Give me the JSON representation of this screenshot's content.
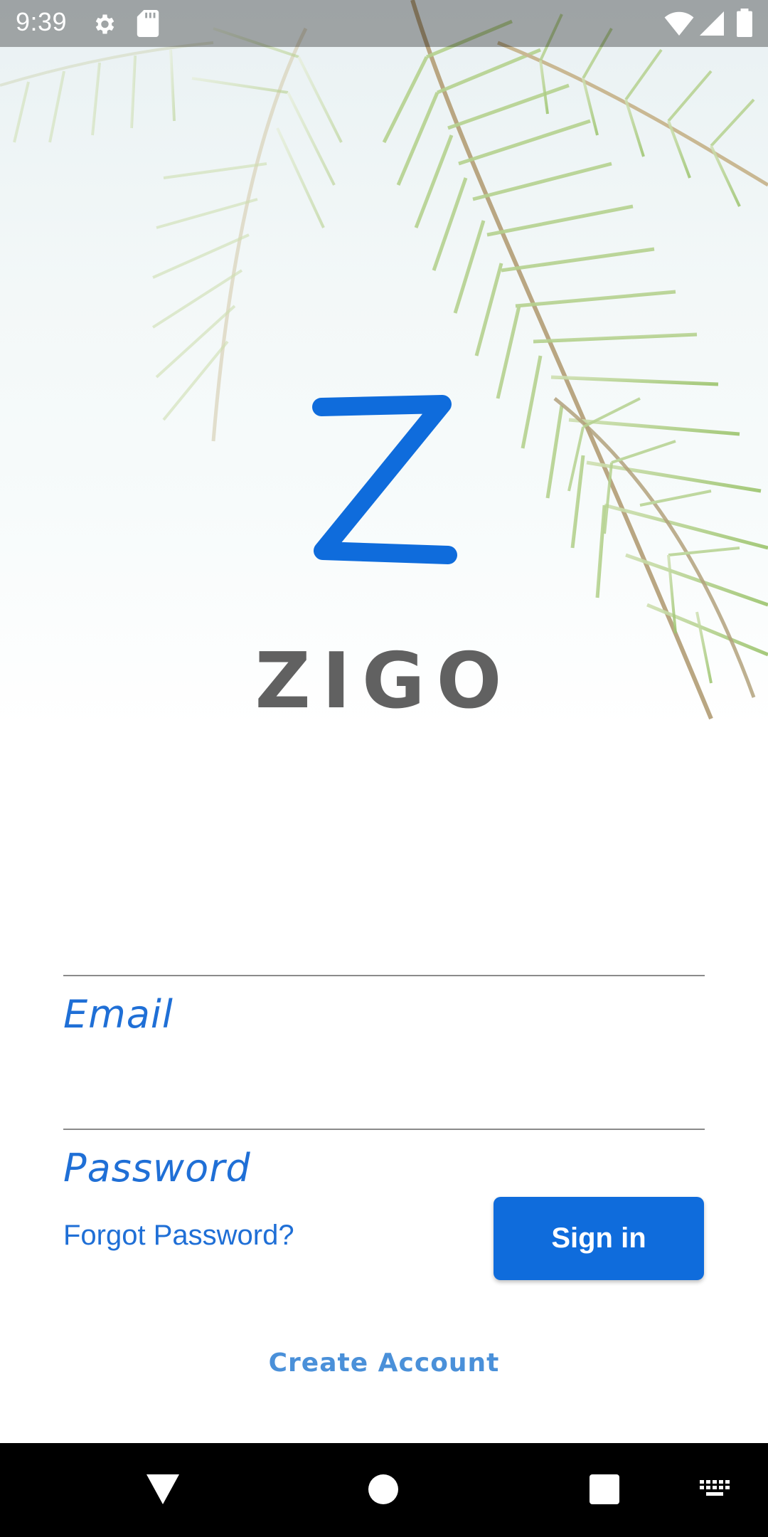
{
  "status_bar": {
    "time": "9:39",
    "icons": [
      "settings-icon",
      "sd-card-icon",
      "wifi-icon",
      "signal-icon",
      "battery-icon"
    ]
  },
  "branding": {
    "logo_letter": "Z",
    "app_name": "ZIGO",
    "accent_color": "#0f6cdc",
    "text_color": "#616161"
  },
  "form": {
    "email_label": "Email",
    "password_label": "Password",
    "forgot_password": "Forgot Password?",
    "sign_in": "Sign in",
    "create_account": "Create Account"
  },
  "nav_bar": {
    "icons": [
      "back-icon",
      "home-icon",
      "recents-icon",
      "keyboard-icon"
    ]
  }
}
